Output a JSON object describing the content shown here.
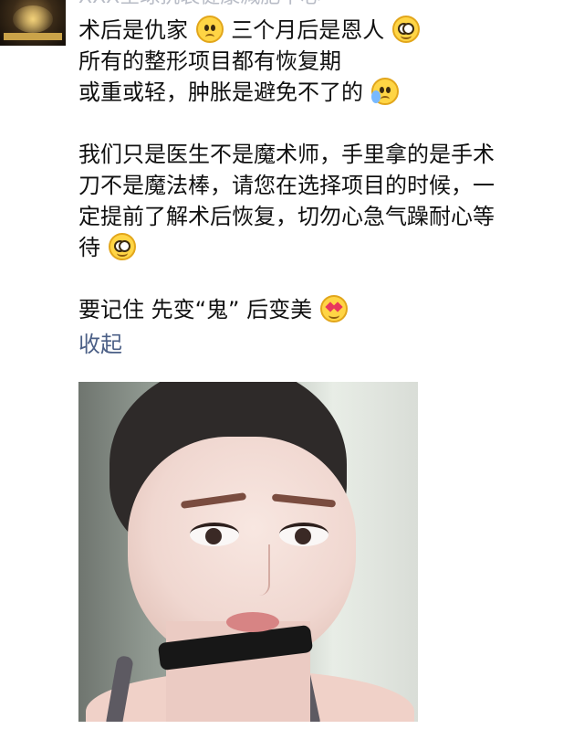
{
  "header": {
    "partial_name": "XXX全球抗衰健康减肥中心"
  },
  "post": {
    "line1": {
      "part1": "术后是仇家",
      "emoji1": "sad-face-emoji",
      "part2": "三个月后是恩人",
      "emoji2": "side-eye-face-emoji"
    },
    "line2": "所有的整形项目都有恢复期",
    "line3": {
      "text": "或重或轻，肿胀是避免不了的",
      "emoji": "crying-face-emoji"
    },
    "paragraph2": {
      "line1": "我们只是医生不是魔术师，手里拿的是手术",
      "line2": "刀不是魔法棒，请您在选择项目的时候，一",
      "line3": "定提前了解术后恢复，切勿心急气躁耐心等",
      "line4": "待",
      "line4_emoji": "dizzy-face-emoji"
    },
    "paragraph3": {
      "text": "要记住 先变“鬼” 后变美",
      "emoji": "heart-eyes-emoji"
    },
    "collapse_label": "收起"
  },
  "media": {
    "photo_subject": "woman-selfie-photo"
  }
}
